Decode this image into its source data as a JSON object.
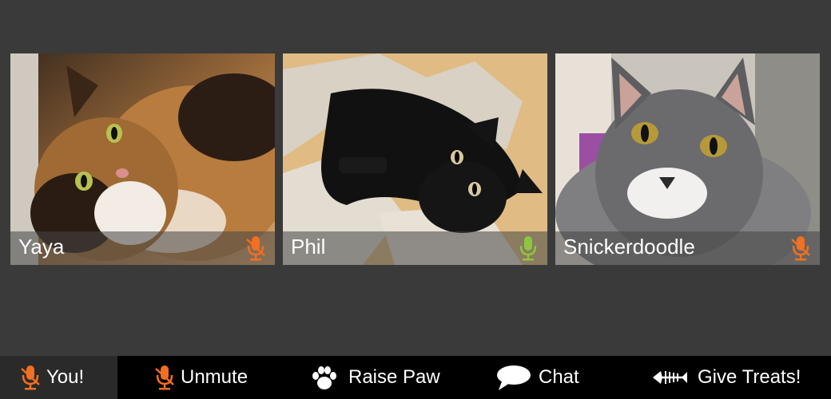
{
  "participants": [
    {
      "name": "Yaya",
      "mic_state": "muted",
      "mic_color": "#f36f21"
    },
    {
      "name": "Phil",
      "mic_state": "speaking",
      "mic_color": "#8dc63f"
    },
    {
      "name": "Snickerdoodle",
      "mic_state": "muted",
      "mic_color": "#f36f21"
    }
  ],
  "toolbar": {
    "self_label": "You!",
    "unmute_label": "Unmute",
    "raise_paw_label": "Raise Paw",
    "chat_label": "Chat",
    "give_treats_label": "Give Treats!"
  },
  "icons": {
    "self": "muted-mic-icon",
    "unmute": "muted-mic-icon",
    "raise_paw": "paw-icon",
    "chat": "speech-bubble-icon",
    "give_treats": "fish-bone-icon"
  },
  "colors": {
    "muted": "#f36f21",
    "speaking": "#8dc63f",
    "background": "#3a3a3a",
    "toolbar": "#000000"
  }
}
